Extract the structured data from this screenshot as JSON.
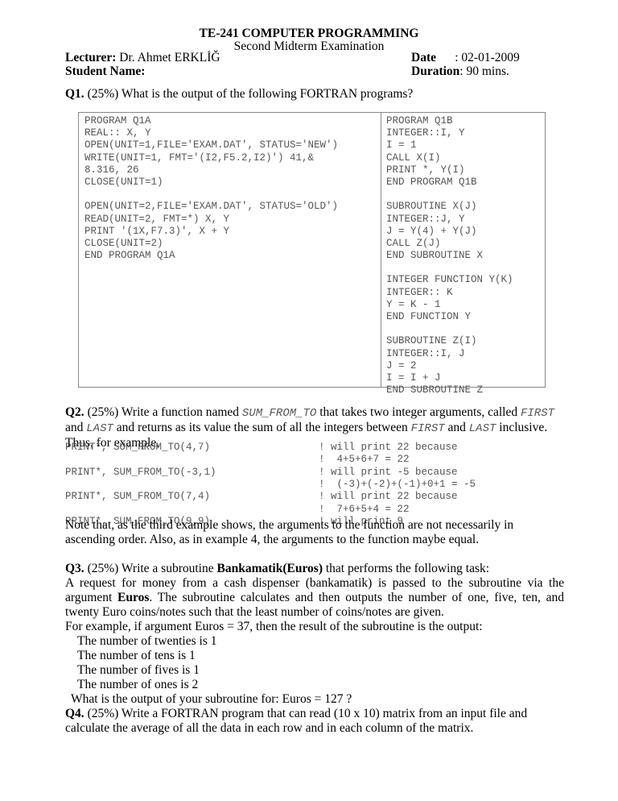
{
  "header": {
    "course_title": "TE-241 COMPUTER PROGRAMMING",
    "exam_title": "Second Midterm Examination",
    "lecturer_label": "Lecturer:",
    "lecturer_value": " Dr. Ahmet ERKLİĞ",
    "student_label": "Student Name:",
    "date_label": "Date",
    "date_value": "      : 02-01-2009",
    "duration_label": "Duration",
    "duration_value": ": 90 mins."
  },
  "q1": {
    "label": "Q1.",
    "text": " (25%) What is the output of the following FORTRAN programs?",
    "left_code": [
      "PROGRAM Q1A",
      "REAL:: X, Y",
      "OPEN(UNIT=1,FILE='EXAM.DAT', STATUS='NEW')",
      "WRITE(UNIT=1, FMT='(I2,F5.2,I2)') 41,&",
      "8.316, 26",
      "CLOSE(UNIT=1)",
      "",
      "OPEN(UNIT=2,FILE='EXAM.DAT', STATUS='OLD')",
      "READ(UNIT=2, FMT=*) X, Y",
      "PRINT '(1X,F7.3)', X + Y",
      "CLOSE(UNIT=2)",
      "END PROGRAM Q1A"
    ],
    "right_code": [
      "PROGRAM Q1B",
      "INTEGER::I, Y",
      "I = 1",
      "CALL X(I)",
      "PRINT *, Y(I)",
      "END PROGRAM Q1B",
      "",
      "SUBROUTINE X(J)",
      "INTEGER::J, Y",
      "J = Y(4) + Y(J)",
      "CALL Z(J)",
      "END SUBROUTINE X",
      "",
      "INTEGER FUNCTION Y(K)",
      "INTEGER:: K",
      "Y = K - 1",
      "END FUNCTION Y",
      "",
      "SUBROUTINE Z(I)",
      "INTEGER::I, J",
      "J = 2",
      "I = I + J",
      "END SUBROUTINE Z"
    ]
  },
  "q2": {
    "label": "Q2.",
    "text_1": " (25%) Write a function named ",
    "func_name": "SUM_FROM_TO",
    "text_2": " that takes two integer arguments, called ",
    "arg_first": "FIRST",
    "text_3": " and ",
    "arg_last": "LAST",
    "text_4": "  and returns as its value the sum of all the integers between ",
    "arg_first_2": "FIRST",
    "text_5": " and ",
    "arg_last_2": "LAST",
    "text_6": " inclusive. Thus, for example,",
    "examples": [
      {
        "call": "PRINT*, SUM_FROM_TO(4,7)",
        "comment": "! will print 22 because"
      },
      {
        "call": "",
        "comment": "!  4+5+6+7 = 22"
      },
      {
        "call": "PRINT*, SUM_FROM_TO(-3,1)",
        "comment": "! will print -5 because"
      },
      {
        "call": "",
        "comment": "!  (-3)+(-2)+(-1)+0+1 = -5"
      },
      {
        "call": "PRINT*, SUM_FROM_TO(7,4)",
        "comment": "! will print 22 because"
      },
      {
        "call": "",
        "comment": "!  7+6+5+4 = 22"
      },
      {
        "call": "PRINT*, SUM_FROM_TO(9,9)",
        "comment": "! will print 9"
      }
    ],
    "note": "Note that, as the third example shows, the arguments to the function are not necessarily in ascending order. Also, as in example 4, the arguments to the function maybe equal."
  },
  "q3": {
    "label": "Q3.",
    "text_1": " (25%) Write a subroutine ",
    "sub_name": "Bankamatik(Euros)",
    "text_2": " that performs the  following task:",
    "para_1a": "A request for money from a cash dispenser (bankamatik) is passed to the subroutine via the argument ",
    "euros_bold": "Euros",
    "para_1b": ". The subroutine calculates  and then outputs the number of one, five, ten, and twenty Euro coins/notes such that the least number of coins/notes are given.",
    "example_intro": "For example, if argument Euros = 37, then the result of the subroutine is the output:",
    "output_lines": [
      "The number of twenties is  1",
      "The number of tens is  1",
      "The number of fives is  1",
      "The number of ones is  2"
    ],
    "question": "What is the output of your subroutine for: Euros = 127 ?"
  },
  "q4": {
    "label": "Q4.",
    "text": " (25%) Write a FORTRAN program that can read (10 x 10) matrix from an input file and calculate the average of all the data in each row and in each column of the matrix."
  }
}
